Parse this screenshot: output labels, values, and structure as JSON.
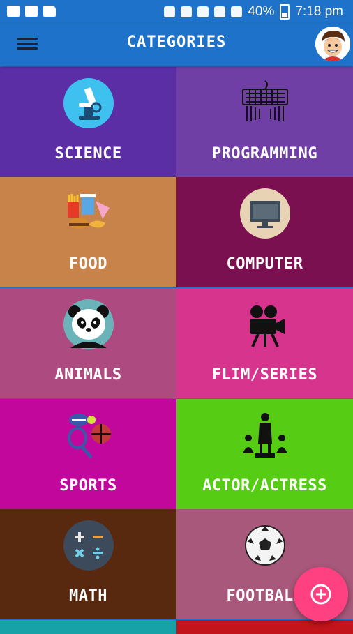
{
  "status_bar": {
    "battery": "40%",
    "time": "7:18 pm"
  },
  "app_bar": {
    "title": "CATEGORIES"
  },
  "categories": [
    {
      "label": "SCIENCE",
      "color": "#5b2ea6",
      "icon": "microscope-icon"
    },
    {
      "label": "PROGRAMMING",
      "color": "#6f3fa6",
      "icon": "keyboard-typing-icon"
    },
    {
      "label": "FOOD",
      "color": "#c8834a",
      "icon": "fast-food-icon"
    },
    {
      "label": "COMPUTER",
      "color": "#7b1050",
      "icon": "monitor-icon"
    },
    {
      "label": "ANIMALS",
      "color": "#ad4b80",
      "icon": "panda-icon"
    },
    {
      "label": "FLIM/SERIES",
      "color": "#d6348d",
      "icon": "movie-camera-icon"
    },
    {
      "label": "SPORTS",
      "color": "#c2089c",
      "icon": "sports-balls-icon"
    },
    {
      "label": "ACTOR/ACTRESS",
      "color": "#56cc14",
      "icon": "actor-award-icon"
    },
    {
      "label": "MATH",
      "color": "#58280f",
      "icon": "calculator-symbols-icon"
    },
    {
      "label": "FOOTBALL",
      "color": "#a8587a",
      "icon": "soccer-ball-icon"
    }
  ],
  "partial_row_colors": [
    "#17a2a8",
    "#c3131b"
  ],
  "fab": {
    "icon": "add-circle-icon",
    "color": "#ff4081"
  }
}
